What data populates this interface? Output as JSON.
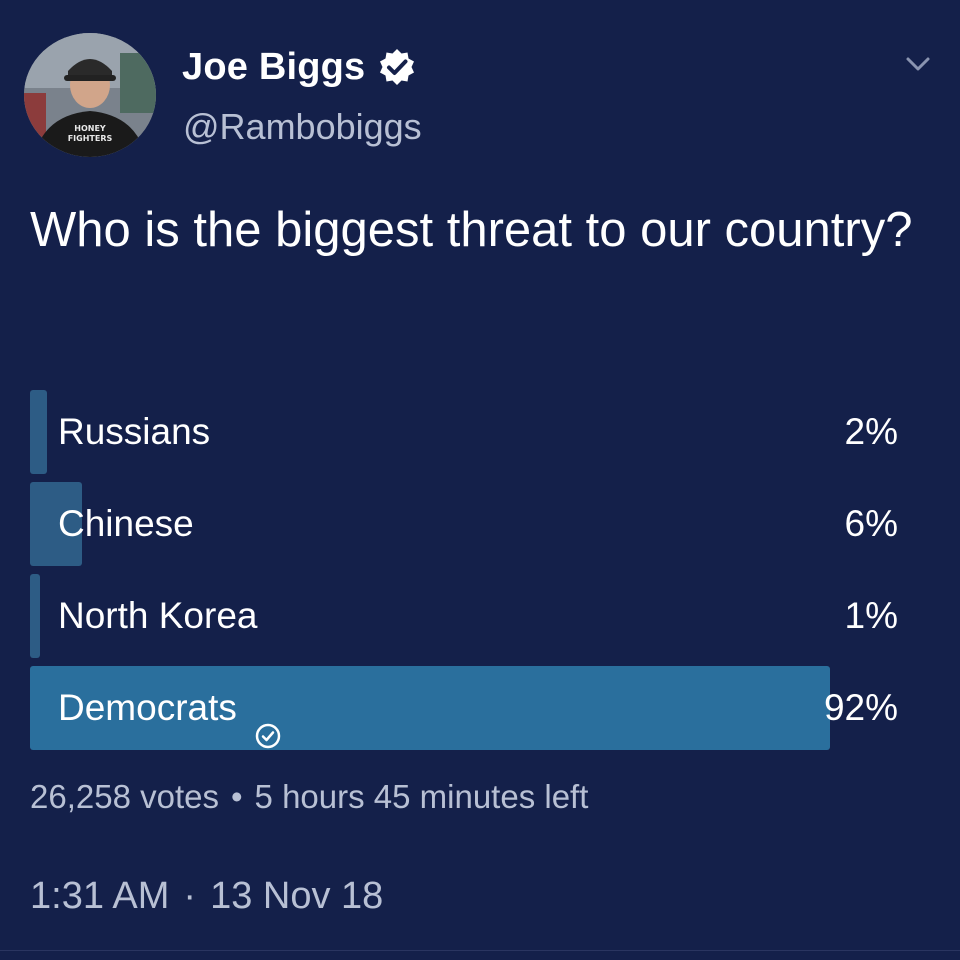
{
  "author": {
    "display_name": "Joe Biggs",
    "handle": "@Rambobiggs",
    "verified": true,
    "avatar_shirt_text": "HONEY FIGHTERS"
  },
  "tweet": {
    "text": "Who is the biggest threat to our country?",
    "timestamp_time": "1:31 AM",
    "timestamp_separator": "·",
    "timestamp_date": "13 Nov 18"
  },
  "poll": {
    "options": [
      {
        "label": "Russians",
        "percent_text": "2%",
        "percent": 2,
        "selected": false
      },
      {
        "label": "Chinese",
        "percent_text": "6%",
        "percent": 6,
        "selected": false
      },
      {
        "label": "North Korea",
        "percent_text": "1%",
        "percent": 1,
        "selected": false
      },
      {
        "label": "Democrats",
        "percent_text": "92%",
        "percent": 92,
        "selected": true
      }
    ],
    "votes_text": "26,258 votes",
    "meta_separator": "•",
    "time_left": "5 hours 45 minutes left"
  },
  "icons": {
    "verified": "verified-badge-icon",
    "caret": "chevron-down-icon",
    "check": "check-circle-icon"
  },
  "colors": {
    "background": "#14204a",
    "bar": "#2d5c85",
    "winner_bar": "#2a6f9d",
    "secondary_text": "#b8c0d4"
  }
}
